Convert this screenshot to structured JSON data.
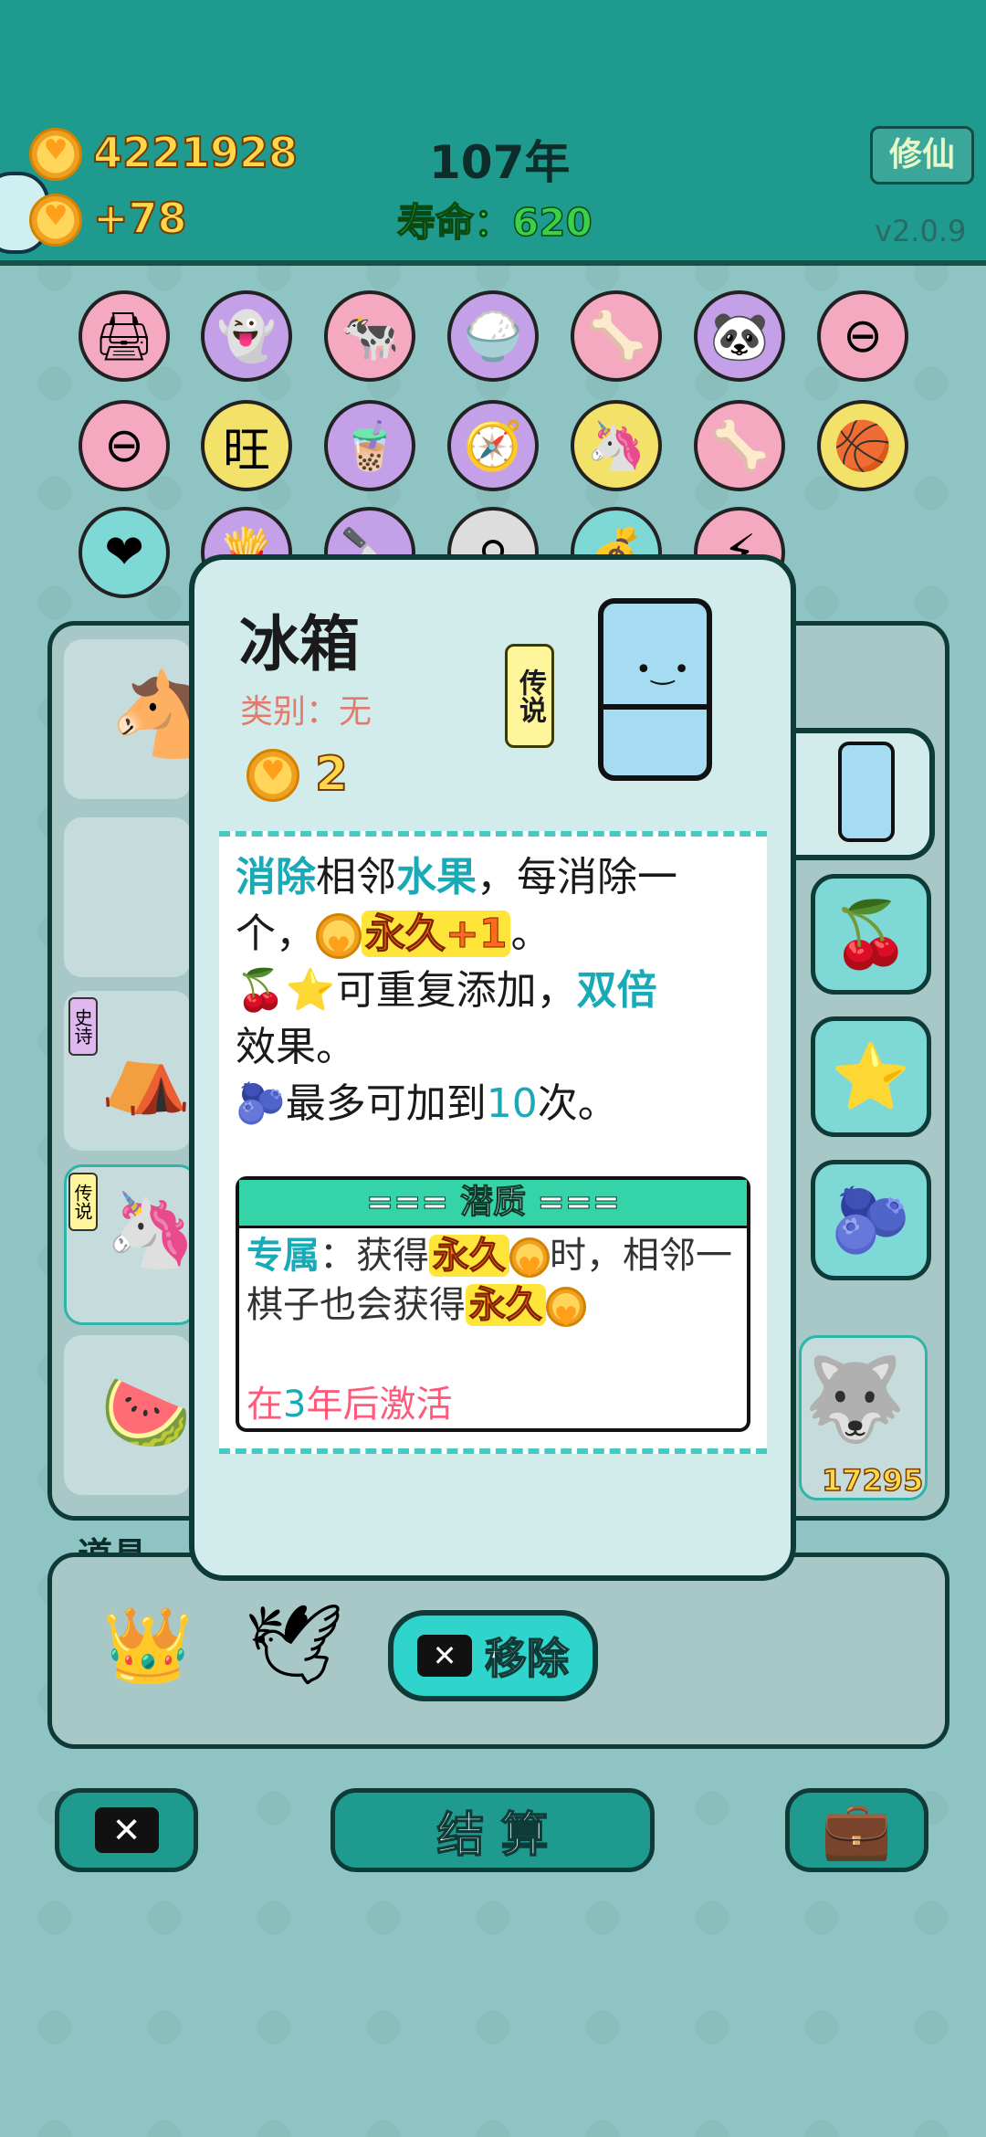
{
  "header": {
    "coins": "4221928",
    "coin_gain": "+78",
    "year": "107年",
    "life_label": "寿命：620",
    "mode_button": "修仙",
    "version": "v2.0.9"
  },
  "board_label": "道具",
  "score_badge": "17295",
  "bottom": {
    "settle_label": "结 算"
  },
  "modal": {
    "title": "冰箱",
    "category": "类别：无",
    "cost": "2",
    "rarity": "传说",
    "desc_line1_a": "消除",
    "desc_line1_b": "相邻",
    "desc_line1_c": "水果",
    "desc_line1_d": "，每消除一",
    "desc_line2_a": "个，",
    "desc_line2_b": "永久+1",
    "desc_line2_c": "。",
    "desc_line3_a": "可重复添加，",
    "desc_line3_b": "双倍",
    "desc_line4": "效果。",
    "desc_line5_a": "最多可加到",
    "desc_line5_b": "10",
    "desc_line5_c": "次。",
    "potential_header": "=== 潜质 ===",
    "potential_a": "专属",
    "potential_b": "：获得",
    "potential_c": "永久",
    "potential_d": "时，相邻一棋子也会获得",
    "potential_e": "永久",
    "activate_a": "在",
    "activate_b": "3",
    "activate_c": "年后激活",
    "remove_label": "移除"
  },
  "side_tags": {
    "epic": "史诗",
    "legend": "传说"
  },
  "icons": [
    "coin-icon",
    "pause-icon",
    "fridge-icon",
    "lychee-icon",
    "star-icon",
    "blueberry-icon",
    "close-icon",
    "briefcase-icon",
    "crown-icon",
    "bird-icon"
  ]
}
